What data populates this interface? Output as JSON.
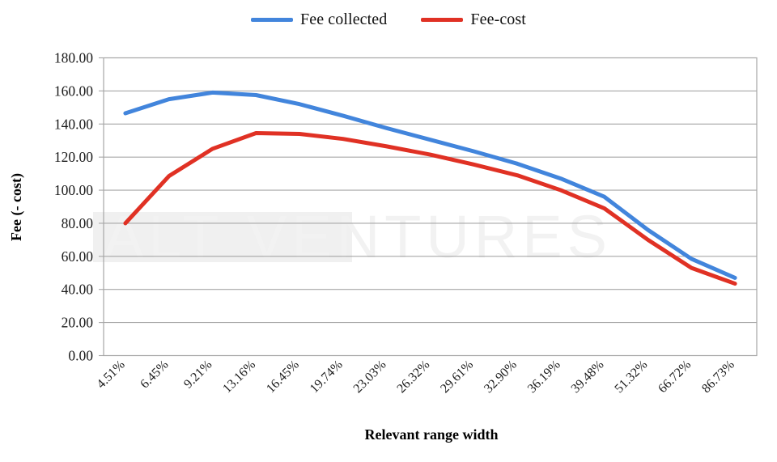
{
  "chart_data": {
    "type": "line",
    "title": "",
    "xlabel": "Relevant range width",
    "ylabel": "Fee (- cost)",
    "categories": [
      "4.51%",
      "6.45%",
      "9.21%",
      "13.16%",
      "16.45%",
      "19.74%",
      "23.03%",
      "26.32%",
      "29.61%",
      "32.90%",
      "36.19%",
      "39.48%",
      "51.32%",
      "66.72%",
      "86.73%"
    ],
    "series": [
      {
        "name": "Fee collected",
        "color": "#4285DC",
        "values": [
          146.5,
          155.0,
          159.0,
          157.5,
          152.0,
          145.0,
          137.5,
          130.5,
          123.5,
          116.0,
          107.0,
          96.0,
          76.0,
          58.5,
          47.0
        ]
      },
      {
        "name": "Fee-cost",
        "color": "#E03124",
        "values": [
          80.0,
          108.5,
          125.0,
          134.5,
          134.0,
          131.0,
          126.5,
          121.5,
          115.5,
          109.0,
          100.0,
          89.0,
          70.0,
          53.0,
          43.5
        ]
      }
    ],
    "ylim": [
      0,
      180
    ],
    "yticks": [
      "0.00",
      "20.00",
      "40.00",
      "60.00",
      "80.00",
      "100.00",
      "120.00",
      "140.00",
      "160.00",
      "180.00"
    ],
    "ytick_values": [
      0,
      20,
      40,
      60,
      80,
      100,
      120,
      140,
      160,
      180
    ],
    "grid": true,
    "grid_color": "#a6a6a6",
    "legend_position": "top-center",
    "xtick_rotation": -45
  },
  "legend": {
    "entries": [
      {
        "label": "Fee collected",
        "color": "#4285DC"
      },
      {
        "label": "Fee-cost",
        "color": "#E03124"
      }
    ]
  },
  "watermark": {
    "text": "ALT VENTURES",
    "part1": "ALT",
    "part2": "VENTURES",
    "color": "#f2f2f2"
  }
}
